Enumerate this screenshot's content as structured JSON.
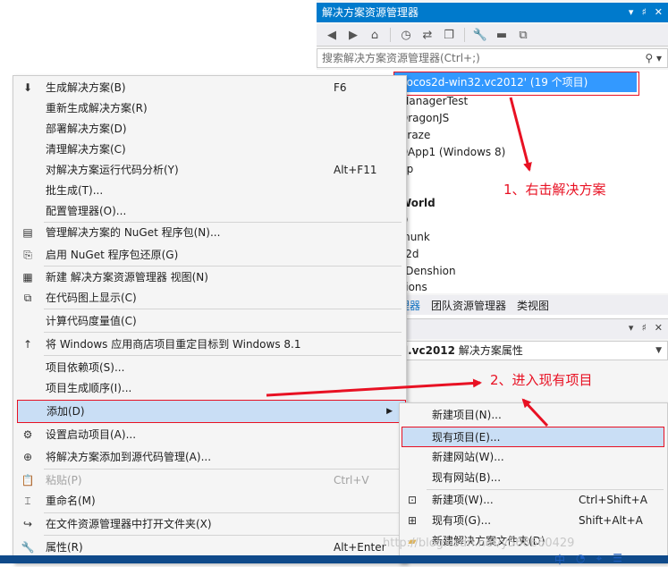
{
  "solution_explorer": {
    "title": "解决方案资源管理器",
    "title_icons": [
      "▾",
      "♯",
      "✕"
    ],
    "toolbar_icons": [
      "back-icon",
      "forward-icon",
      "home-icon",
      "history-icon",
      "sync-icon",
      "collapse-icon",
      "properties-icon",
      "pin-icon",
      "class-diagram-icon"
    ],
    "search_placeholder": "搜索解决方案资源管理器(Ctrl+;)",
    "selected_item": "cocos2d-win32.vc2012' (19 个项目)",
    "tree_items": [
      {
        "label": "ManagerTest",
        "bold": false
      },
      {
        "label": "DragonJS",
        "bold": false
      },
      {
        "label": "Craze",
        "bold": false
      },
      {
        "label": "DApp1 (Windows 8)",
        "bold": false
      },
      {
        "label": "pp",
        "bold": false
      },
      {
        "label": "a",
        "bold": false
      },
      {
        "label": "World",
        "bold": true
      },
      {
        "label": "D",
        "bold": false
      },
      {
        "label": "munk",
        "bold": false
      },
      {
        "label": "s2d",
        "bold": false
      },
      {
        "label": "sDenshion",
        "bold": false
      },
      {
        "label": "sions",
        "bold": false
      }
    ],
    "tabs": [
      "理器",
      "团队资源管理器",
      "类视图"
    ]
  },
  "properties": {
    "title_icons": [
      "▾",
      "♯",
      "✕"
    ],
    "object_name": "l.vc2012",
    "object_type": "解决方案属性"
  },
  "context_menu": {
    "items": [
      {
        "label": "生成解决方案(B)",
        "shortcut": "F6",
        "icon": "build-icon"
      },
      {
        "label": "重新生成解决方案(R)",
        "shortcut": "",
        "icon": ""
      },
      {
        "label": "部署解决方案(D)",
        "shortcut": "",
        "icon": ""
      },
      {
        "label": "清理解决方案(C)",
        "shortcut": "",
        "icon": ""
      },
      {
        "label": "对解决方案运行代码分析(Y)",
        "shortcut": "Alt+F11",
        "icon": ""
      },
      {
        "label": "批生成(T)...",
        "shortcut": "",
        "icon": ""
      },
      {
        "label": "配置管理器(O)...",
        "shortcut": "",
        "icon": ""
      },
      {
        "label": "管理解决方案的 NuGet 程序包(N)...",
        "shortcut": "",
        "icon": "nuget-icon"
      },
      {
        "label": "启用 NuGet 程序包还原(G)",
        "shortcut": "",
        "icon": "package-restore-icon"
      },
      {
        "label": "新建 解决方案资源管理器 视图(N)",
        "shortcut": "",
        "icon": "new-view-icon"
      },
      {
        "label": "在代码图上显示(C)",
        "shortcut": "",
        "icon": "code-map-icon"
      },
      {
        "label": "计算代码度量值(C)",
        "shortcut": "",
        "icon": ""
      },
      {
        "label": "将 Windows 应用商店项目重定目标到 Windows 8.1",
        "shortcut": "",
        "icon": "retarget-icon"
      },
      {
        "label": "项目依赖项(S)...",
        "shortcut": "",
        "icon": ""
      },
      {
        "label": "项目生成顺序(I)...",
        "shortcut": "",
        "icon": ""
      },
      {
        "label": "添加(D)",
        "shortcut": "",
        "icon": "",
        "submenu": "▶"
      },
      {
        "label": "设置启动项目(A)...",
        "shortcut": "",
        "icon": "gear-icon"
      },
      {
        "label": "将解决方案添加到源代码管理(A)...",
        "shortcut": "",
        "icon": "source-control-icon"
      },
      {
        "label": "粘贴(P)",
        "shortcut": "Ctrl+V",
        "icon": "paste-icon",
        "disabled": true
      },
      {
        "label": "重命名(M)",
        "shortcut": "",
        "icon": "rename-icon"
      },
      {
        "label": "在文件资源管理器中打开文件夹(X)",
        "shortcut": "",
        "icon": "open-folder-icon"
      },
      {
        "label": "属性(R)",
        "shortcut": "Alt+Enter",
        "icon": "wrench-icon"
      }
    ]
  },
  "sub_menu": {
    "items": [
      {
        "label": "新建项目(N)...",
        "shortcut": "",
        "icon": ""
      },
      {
        "label": "现有项目(E)...",
        "shortcut": "",
        "icon": ""
      },
      {
        "label": "新建网站(W)...",
        "shortcut": "",
        "icon": ""
      },
      {
        "label": "现有网站(B)...",
        "shortcut": "",
        "icon": ""
      },
      {
        "label": "新建项(W)...",
        "shortcut": "Ctrl+Shift+A",
        "icon": "new-item-icon"
      },
      {
        "label": "现有项(G)...",
        "shortcut": "Shift+Alt+A",
        "icon": "existing-item-icon"
      },
      {
        "label": "新建解决方案文件夹(D)",
        "shortcut": "",
        "icon": "folder-icon"
      }
    ]
  },
  "annotations": {
    "step1": "1、右击解决方案",
    "step2": "2、进入现有项目",
    "color": "#e81123"
  },
  "watermark": "http://blog.csdn.net/y568660429",
  "tray": [
    "中",
    "◔",
    "⌖",
    "☰"
  ],
  "colors": {
    "accent": "#007acc",
    "selection": "#3399ff",
    "menu_highlight": "#c9def5",
    "annotation_red": "#e81123"
  }
}
